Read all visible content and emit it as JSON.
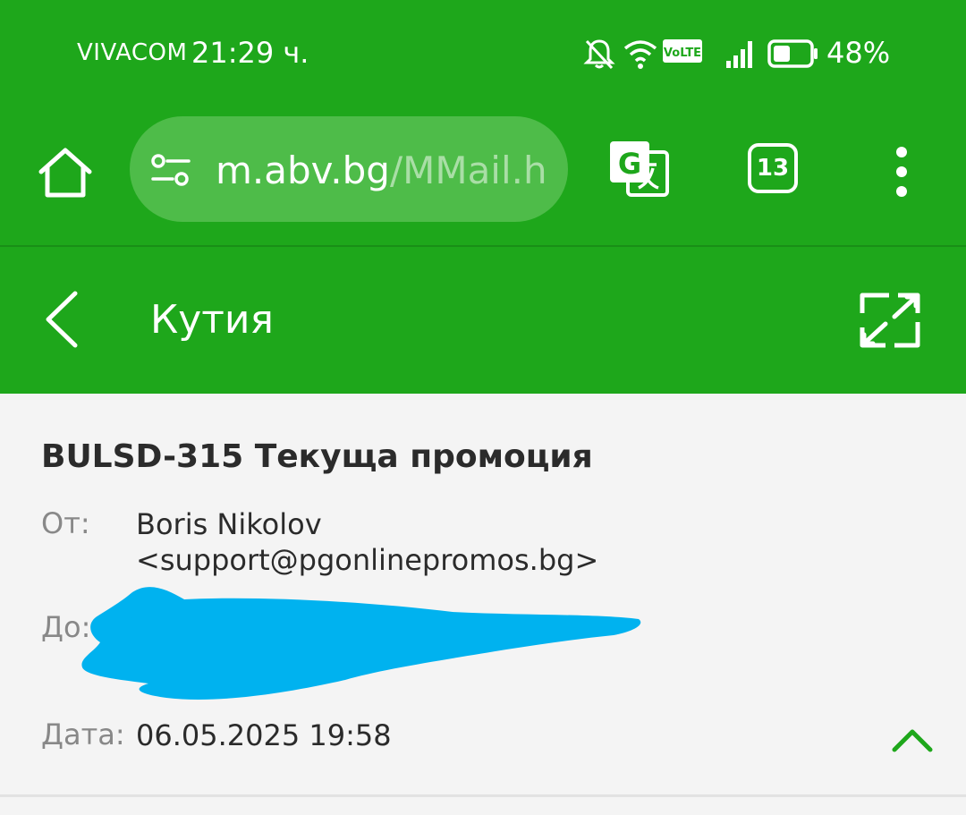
{
  "status_bar": {
    "carrier": "VIVACOM",
    "time": "21:29 ч.",
    "volte_label": "VoLTE",
    "battery_percent": "48%",
    "battery_level": 0.48,
    "icons": [
      "bell-off-icon",
      "wifi-icon",
      "volte-icon",
      "signal-icon",
      "battery-icon"
    ]
  },
  "browser": {
    "url_host": "m.abv.bg",
    "url_path": "/MMail.h",
    "tab_count": "13",
    "icons": [
      "home-icon",
      "tune-icon",
      "translate-icon",
      "more-vert-icon"
    ]
  },
  "mail_header": {
    "title": "Кутия",
    "icons": [
      "back-arrow-icon",
      "expand-icon"
    ]
  },
  "message": {
    "subject": "BULSD-315 Текуща промоция",
    "from_label": "От:",
    "from_name": "Boris Nikolov",
    "from_email": "<support@pgonlinepromos.bg>",
    "to_label": "До:",
    "date_label": "Дата:",
    "date_value": "06.05.2025 19:58",
    "icons": [
      "chevron-up-icon"
    ]
  },
  "colors": {
    "brand_green": "#1ea71b",
    "url_bar": "#4ebc49",
    "redaction": "#00b2ef",
    "accent_chevron": "#1ea71b"
  }
}
